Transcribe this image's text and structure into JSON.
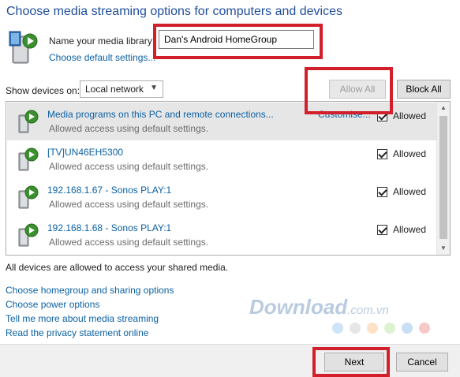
{
  "title": "Choose media streaming options for computers and devices",
  "library": {
    "label": "Name your media library:",
    "value": "Dan's Android HomeGroup",
    "default_link": "Choose default settings..."
  },
  "filter": {
    "label": "Show devices on:",
    "selected": "Local network"
  },
  "buttons": {
    "allow_all": "Allow All",
    "block_all": "Block All",
    "next": "Next",
    "cancel": "Cancel"
  },
  "devices": [
    {
      "name": "Media programs on this PC and remote connections...",
      "status": "Allowed access using default settings.",
      "customise": "Customise...",
      "allowed_label": "Allowed",
      "allowed": true
    },
    {
      "name": "[TV]UN46EH5300",
      "status": "Allowed access using default settings.",
      "allowed_label": "Allowed",
      "allowed": true
    },
    {
      "name": "192.168.1.67 - Sonos PLAY:1",
      "status": "Allowed access using default settings.",
      "allowed_label": "Allowed",
      "allowed": true
    },
    {
      "name": "192.168.1.68 - Sonos PLAY:1",
      "status": "Allowed access using default settings.",
      "allowed_label": "Allowed",
      "allowed": true
    }
  ],
  "info_text": "All devices are allowed to access your shared media.",
  "links": [
    "Choose homegroup and sharing options",
    "Choose power options",
    "Tell me more about media streaming",
    "Read the privacy statement online"
  ],
  "watermark": {
    "text": "Download",
    "tld": ".com.vn"
  },
  "colors": {
    "title": "#1f4e9c",
    "link": "#0b61a4",
    "highlight": "#d21f2c",
    "selected_row": "#e6e6e6",
    "watermark_dots": [
      "#cfe4f7",
      "#e6e6e6",
      "#fde2c8",
      "#dff2cf",
      "#c8def5",
      "#f7c8c8"
    ]
  },
  "icons": {
    "library": "media-library-icon",
    "device": "media-device-icon",
    "dropdown": "chevron-down-icon"
  }
}
